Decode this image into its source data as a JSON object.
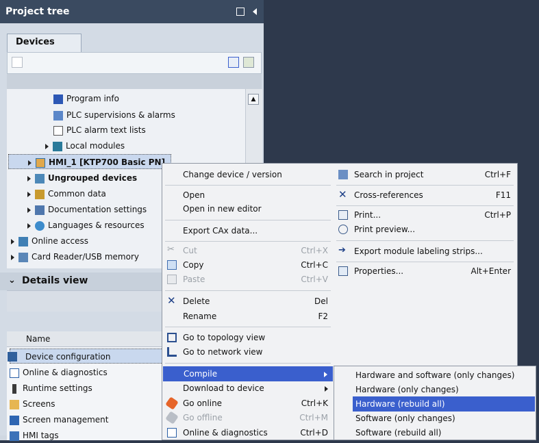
{
  "project_tree": {
    "title": "Project tree",
    "tab": "Devices",
    "items": [
      {
        "label": "Program info"
      },
      {
        "label": "PLC supervisions & alarms"
      },
      {
        "label": "PLC alarm text lists"
      },
      {
        "label": "Local modules"
      },
      {
        "label": "HMI_1 [KTP700 Basic PN]"
      },
      {
        "label": "Ungrouped devices"
      },
      {
        "label": "Common data"
      },
      {
        "label": "Documentation settings"
      },
      {
        "label": "Languages & resources"
      },
      {
        "label": "Online access"
      },
      {
        "label": "Card Reader/USB memory"
      }
    ]
  },
  "details_view": {
    "title": "Details view",
    "column_name": "Name",
    "items": [
      {
        "label": "Device configuration"
      },
      {
        "label": "Online & diagnostics"
      },
      {
        "label": "Runtime settings"
      },
      {
        "label": "Screens"
      },
      {
        "label": "Screen management"
      },
      {
        "label": "HMI tags"
      }
    ]
  },
  "context_menu": {
    "change_device": "Change device / version",
    "open": "Open",
    "open_new_editor": "Open in new editor",
    "export_cax": "Export CAx data...",
    "cut": {
      "label": "Cut",
      "shortcut": "Ctrl+X"
    },
    "copy": {
      "label": "Copy",
      "shortcut": "Ctrl+C"
    },
    "paste": {
      "label": "Paste",
      "shortcut": "Ctrl+V"
    },
    "delete": {
      "label": "Delete",
      "shortcut": "Del"
    },
    "rename": {
      "label": "Rename",
      "shortcut": "F2"
    },
    "topology": "Go to topology view",
    "network": "Go to network view",
    "compile": "Compile",
    "download": "Download to device",
    "go_online": {
      "label": "Go online",
      "shortcut": "Ctrl+K"
    },
    "go_offline": {
      "label": "Go offline",
      "shortcut": "Ctrl+M"
    },
    "online_diag": {
      "label": "Online & diagnostics",
      "shortcut": "Ctrl+D"
    }
  },
  "right_menu": {
    "search": {
      "label": "Search in project",
      "shortcut": "Ctrl+F"
    },
    "cross": {
      "label": "Cross-references",
      "shortcut": "F11"
    },
    "print": {
      "label": "Print...",
      "shortcut": "Ctrl+P"
    },
    "print_preview": "Print preview...",
    "export_strips": "Export module labeling strips...",
    "properties": {
      "label": "Properties...",
      "shortcut": "Alt+Enter"
    }
  },
  "compile_submenu": {
    "items": [
      "Hardware and software (only changes)",
      "Hardware (only changes)",
      "Hardware (rebuild all)",
      "Software (only changes)",
      "Software (rebuild all)"
    ]
  },
  "colors": {
    "highlight": "#3a5fcd",
    "header": "#3a4a60"
  }
}
